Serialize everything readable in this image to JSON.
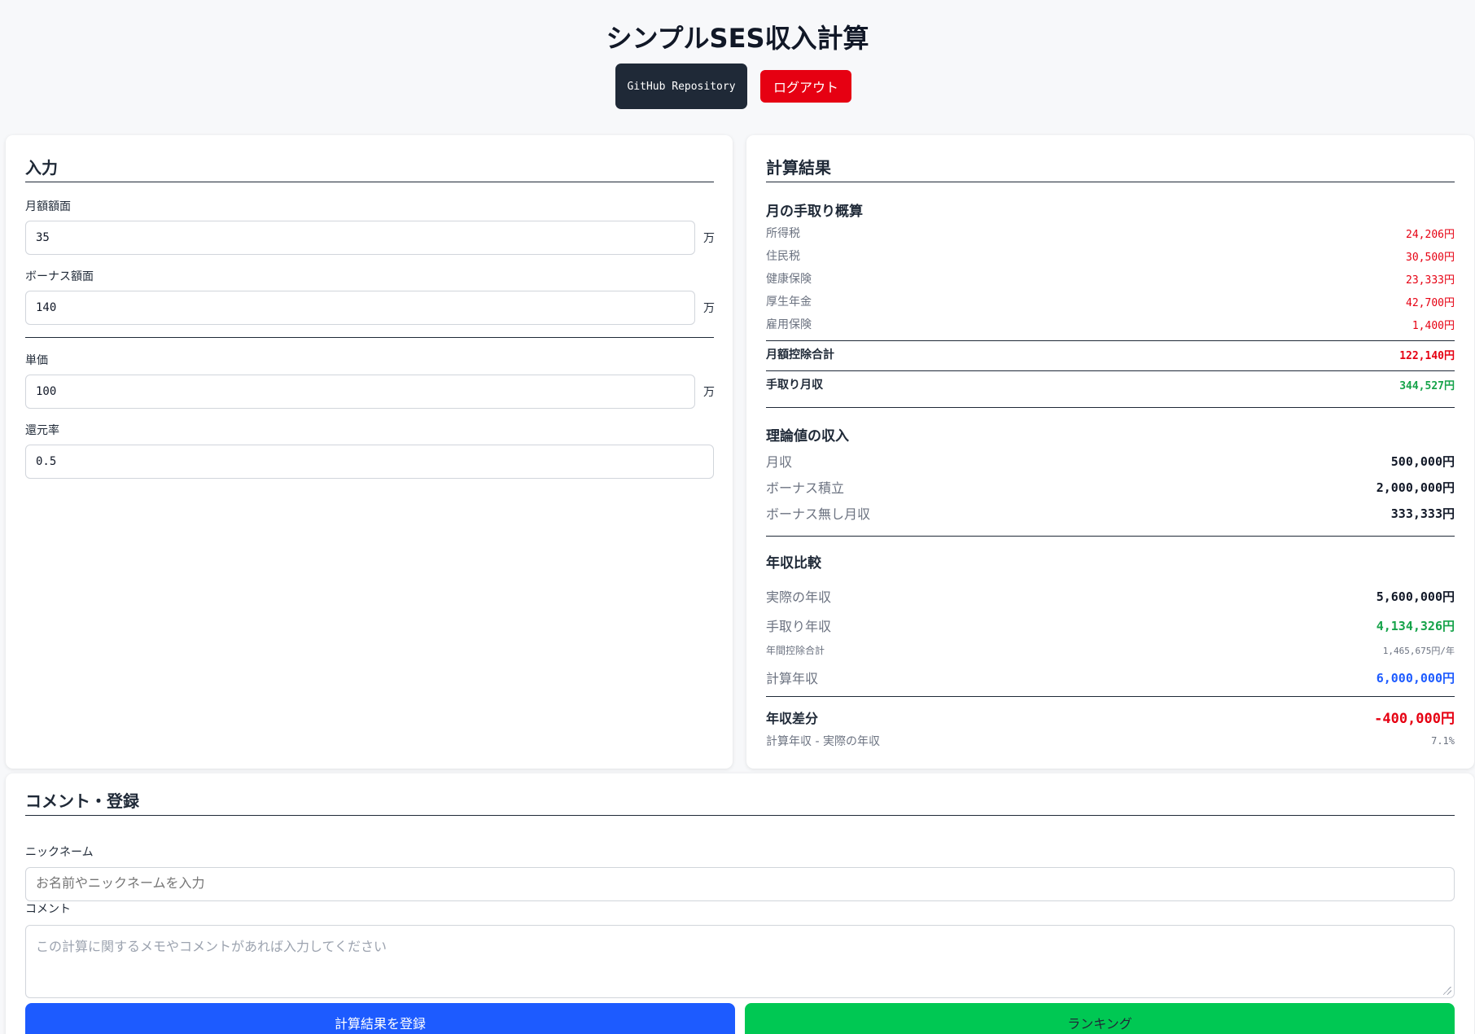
{
  "header": {
    "title": "シンプルSES収入計算",
    "github_label": "GitHub Repository",
    "logout_label": "ログアウト"
  },
  "input": {
    "title": "入力",
    "monthly_label": "月額額面",
    "monthly_value": "35",
    "bonus_label": "ボーナス額面",
    "bonus_value": "140",
    "unit_price_label": "単価",
    "unit_price_value": "100",
    "return_rate_label": "還元率",
    "return_rate_value": "0.5",
    "unit_man": "万"
  },
  "result": {
    "title": "計算結果",
    "monthly_net": {
      "title": "月の手取り概算",
      "items": [
        {
          "label": "所得税",
          "value": "24,206円"
        },
        {
          "label": "住民税",
          "value": "30,500円"
        },
        {
          "label": "健康保険",
          "value": "23,333円"
        },
        {
          "label": "厚生年金",
          "value": "42,700円"
        },
        {
          "label": "雇用保険",
          "value": "1,400円"
        }
      ],
      "deduction_total_label": "月額控除合計",
      "deduction_total_value": "122,140円",
      "net_label": "手取り月収",
      "net_value": "344,527円"
    },
    "theoretical": {
      "title": "理論値の収入",
      "monthly_label": "月収",
      "monthly_value": "500,000円",
      "bonus_label": "ボーナス積立",
      "bonus_value": "2,000,000円",
      "no_bonus_label": "ボーナス無し月収",
      "no_bonus_value": "333,333円"
    },
    "annual": {
      "title": "年収比較",
      "actual_label": "実際の年収",
      "actual_value": "5,600,000円",
      "net_label": "手取り年収",
      "net_value": "4,134,326円",
      "deduction_label": "年間控除合計",
      "deduction_value": "1,465,675円/年",
      "calc_label": "計算年収",
      "calc_value": "6,000,000円",
      "diff_label": "年収差分",
      "diff_value": "-400,000円",
      "diff_formula": "計算年収 - 実際の年収",
      "diff_percent": "7.1%"
    }
  },
  "comment": {
    "title": "コメント・登録",
    "nickname_label": "ニックネーム",
    "nickname_placeholder": "お名前やニックネームを入力",
    "comment_label": "コメント",
    "comment_placeholder": "この計算に関するメモやコメントがあれば入力してください",
    "register_label": "計算結果を登録",
    "ranking_label": "ランキング"
  },
  "colors": {
    "register": "#1d5bff",
    "ranking": "#00c853",
    "logout": "#e60012",
    "github": "#1f2937"
  }
}
